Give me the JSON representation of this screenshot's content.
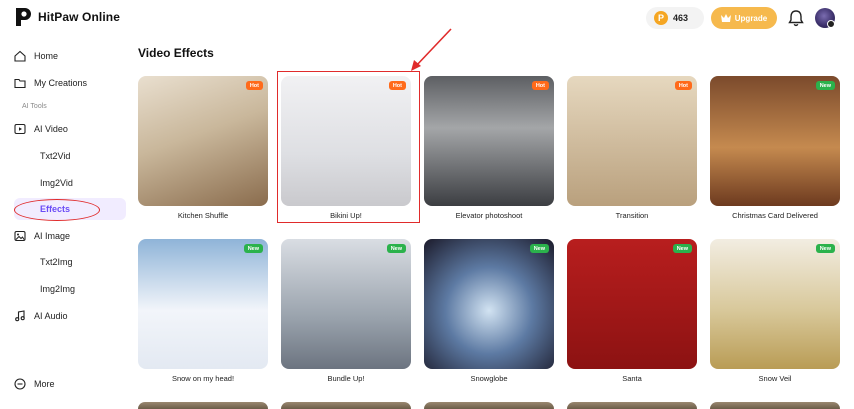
{
  "app": {
    "name": "HitPaw Online"
  },
  "header": {
    "credits": "463",
    "upgrade_label": "Upgrade"
  },
  "sidebar": {
    "section_label": "AI Tools",
    "items": [
      {
        "label": "Home",
        "icon": "home-icon"
      },
      {
        "label": "My Creations",
        "icon": "folder-icon"
      },
      {
        "label": "AI Video",
        "icon": "video-icon"
      },
      {
        "label": "Txt2Vid"
      },
      {
        "label": "Img2Vid"
      },
      {
        "label": "Effects",
        "active": true
      },
      {
        "label": "AI Image",
        "icon": "image-icon"
      },
      {
        "label": "Txt2Img"
      },
      {
        "label": "Img2Img"
      },
      {
        "label": "AI Audio",
        "icon": "music-note-icon"
      },
      {
        "label": "More",
        "icon": "more-circle-icon"
      }
    ]
  },
  "main": {
    "title": "Video Effects",
    "cards": [
      {
        "caption": "Kitchen Shuffle",
        "badge": "Hot"
      },
      {
        "caption": "Bikini Up!",
        "badge": "Hot"
      },
      {
        "caption": "Elevator photoshoot",
        "badge": "Hot"
      },
      {
        "caption": "Transition",
        "badge": "Hot"
      },
      {
        "caption": "Christmas Card Delivered",
        "badge": "New"
      },
      {
        "caption": "Snow on my head!",
        "badge": "New"
      },
      {
        "caption": "Bundle Up!",
        "badge": "New"
      },
      {
        "caption": "Snowglobe",
        "badge": "New"
      },
      {
        "caption": "Santa",
        "badge": "New"
      },
      {
        "caption": "Snow Veil",
        "badge": "New"
      }
    ]
  },
  "colors": {
    "accent": "#6b4cf6",
    "upgrade": "#f6b94d",
    "hot": "#ff6a1a",
    "new": "#2bb24c",
    "annotation": "#e02b2b"
  }
}
